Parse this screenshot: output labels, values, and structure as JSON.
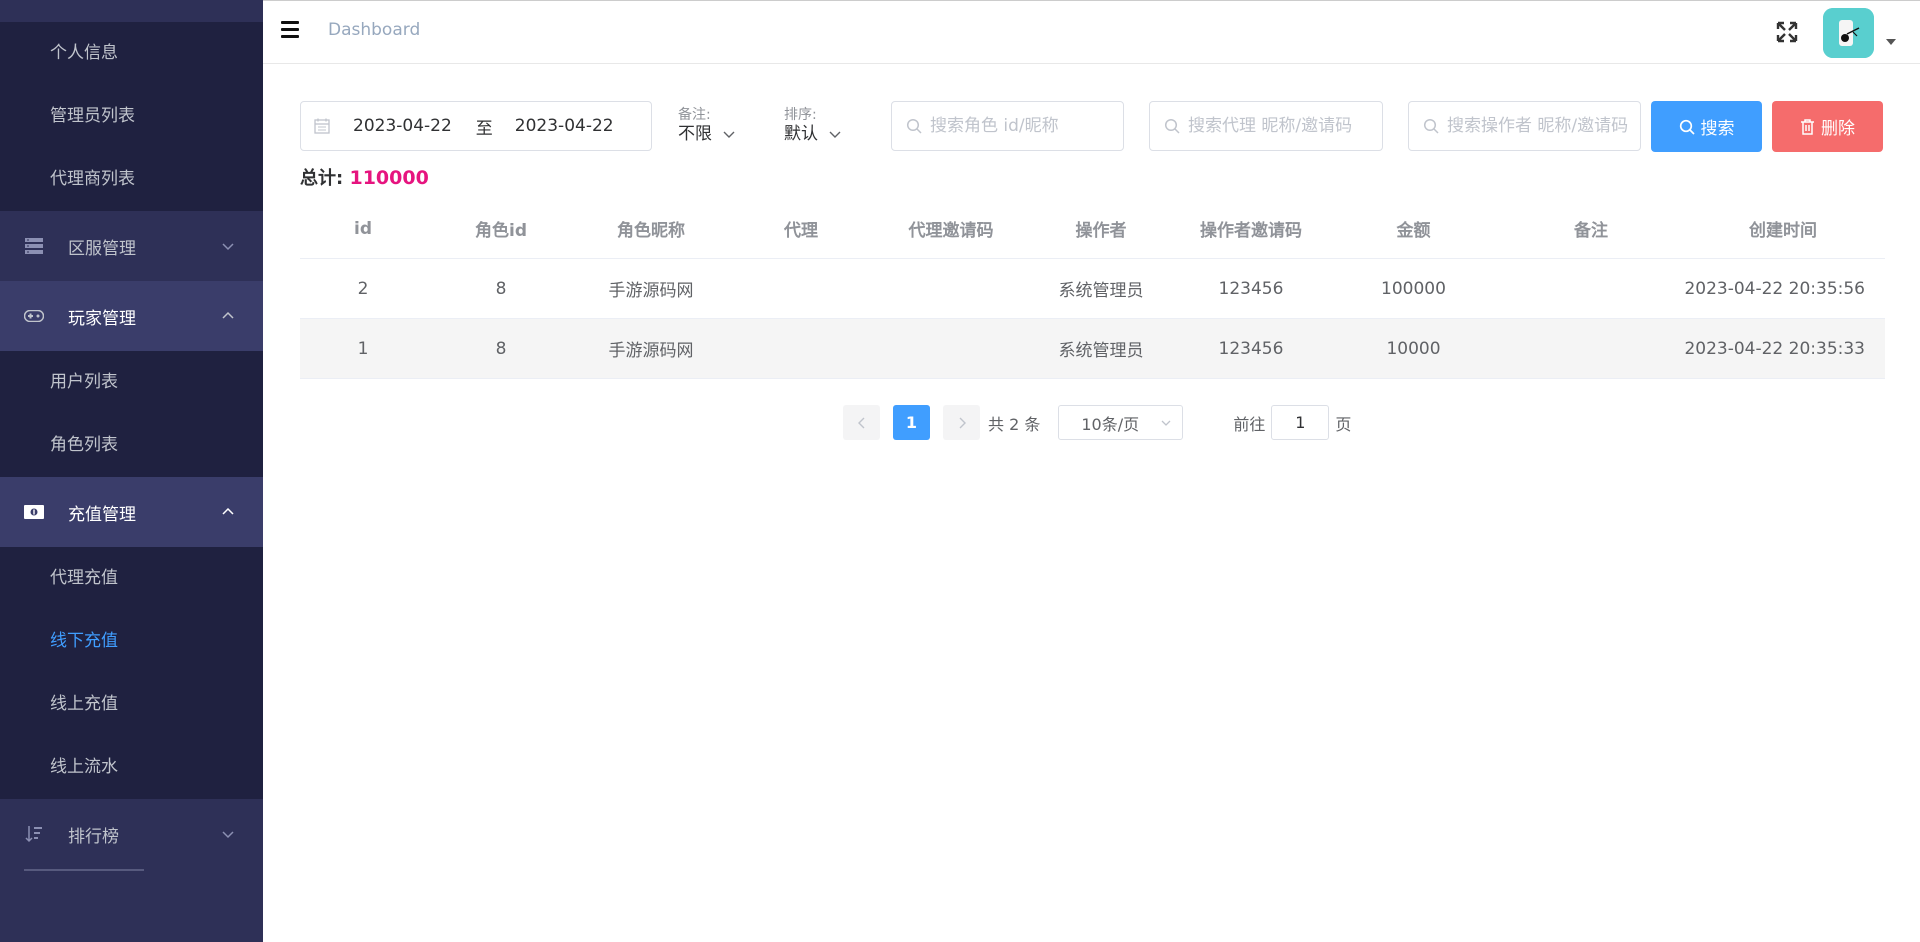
{
  "sidebar": {
    "group1": [
      {
        "label": "个人信息"
      },
      {
        "label": "管理员列表"
      },
      {
        "label": "代理商列表"
      }
    ],
    "menus": {
      "server": {
        "label": "区服管理",
        "icon": "server-icon"
      },
      "player": {
        "label": "玩家管理",
        "icon": "gamepad-icon"
      },
      "recharge": {
        "label": "充值管理",
        "icon": "money-icon"
      },
      "rank": {
        "label": "排行榜",
        "icon": "sort-icon"
      }
    },
    "group2": [
      {
        "label": "用户列表"
      },
      {
        "label": "角色列表"
      }
    ],
    "group3": [
      {
        "label": "代理充值"
      },
      {
        "label": "线下充值",
        "active": true
      },
      {
        "label": "线上充值"
      },
      {
        "label": "线上流水"
      }
    ]
  },
  "header": {
    "breadcrumb": "Dashboard",
    "icons": [
      "hamburger-icon",
      "fullscreen-icon",
      "avatar",
      "caret-down-icon"
    ]
  },
  "filters": {
    "date_start": "2023-04-22",
    "date_sep": "至",
    "date_end": "2023-04-22",
    "remark_label": "备注:",
    "remark_value": "不限",
    "sort_label": "排序:",
    "sort_value": "默认",
    "search_role_placeholder": "搜索角色 id/昵称",
    "search_agent_placeholder": "搜索代理 昵称/邀请码",
    "search_operator_placeholder": "搜索操作者 昵称/邀请码",
    "search_button": "搜索",
    "delete_button": "删除"
  },
  "summary": {
    "label": "总计:",
    "value": "110000",
    "value_color": "#e6147f"
  },
  "table": {
    "columns": [
      "id",
      "角色id",
      "角色昵称",
      "代理",
      "代理邀请码",
      "操作者",
      "操作者邀请码",
      "金额",
      "备注",
      "创建时间"
    ],
    "rows": [
      [
        "2",
        "8",
        "手游源码网",
        "",
        "",
        "系统管理员",
        "123456",
        "100000",
        "",
        "2023-04-22 20:35:56"
      ],
      [
        "1",
        "8",
        "手游源码网",
        "",
        "",
        "系统管理员",
        "123456",
        "10000",
        "",
        "2023-04-22 20:35:33"
      ]
    ]
  },
  "pagination": {
    "current": "1",
    "total_text": "共 2 条",
    "page_size": "10条/页",
    "goto_label": "前往",
    "goto_value": "1",
    "goto_suffix": "页"
  },
  "colors": {
    "sidebar_bg": "#2e3057",
    "sidebar_sub_bg": "#1f2140",
    "primary": "#409eff",
    "danger": "#f56c6c",
    "avatar_bg": "#59cfcf"
  }
}
